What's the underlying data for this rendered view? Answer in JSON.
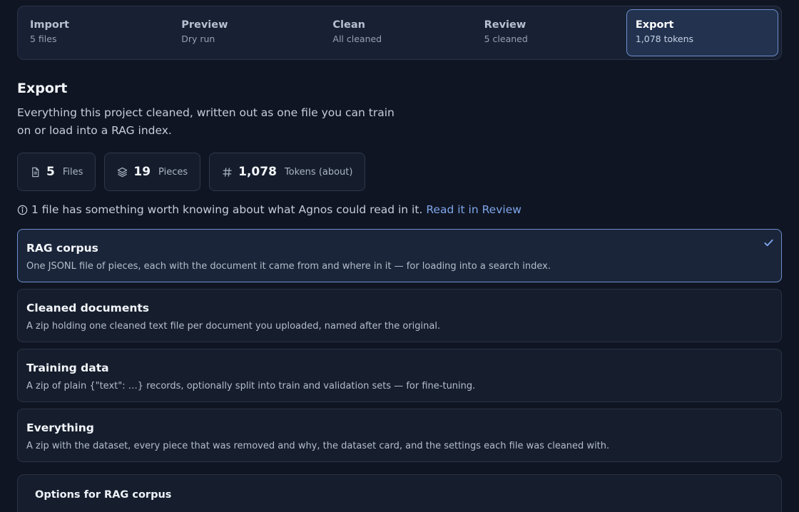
{
  "stepper": {
    "steps": [
      {
        "title": "Import",
        "subtitle": "5 files"
      },
      {
        "title": "Preview",
        "subtitle": "Dry run"
      },
      {
        "title": "Clean",
        "subtitle": "All cleaned"
      },
      {
        "title": "Review",
        "subtitle": "5 cleaned"
      },
      {
        "title": "Export",
        "subtitle": "1,078 tokens"
      }
    ],
    "active_index": 4
  },
  "heading": "Export",
  "intro": "Everything this project cleaned, written out as one file you can train on or load into a RAG index.",
  "stats": [
    {
      "icon": "file-icon",
      "value": "5",
      "label": "Files"
    },
    {
      "icon": "layers-icon",
      "value": "19",
      "label": "Pieces"
    },
    {
      "icon": "hash-icon",
      "value": "1,078",
      "label": "Tokens (about)"
    }
  ],
  "notice": {
    "icon": "info-icon",
    "text": "1 file has something worth knowing about what Agnos could read in it.",
    "link_label": "Read it in Review"
  },
  "formats": [
    {
      "title": "RAG corpus",
      "description": "One JSONL file of pieces, each with the document it came from and where in it — for loading into a search index.",
      "selected": true
    },
    {
      "title": "Cleaned documents",
      "description": "A zip holding one cleaned text file per document you uploaded, named after the original.",
      "selected": false
    },
    {
      "title": "Training data",
      "description": "A zip of plain {\"text\": …} records, optionally split into train and validation sets — for fine-tuning.",
      "selected": false
    },
    {
      "title": "Everything",
      "description": "A zip with the dataset, every piece that was removed and why, the dataset card, and the settings each file was cleaned with.",
      "selected": false
    }
  ],
  "options": {
    "title": "Options for RAG corpus"
  },
  "colors": {
    "accent": "#6f8fce",
    "link": "#7fa6ec",
    "background": "#0f1522"
  }
}
